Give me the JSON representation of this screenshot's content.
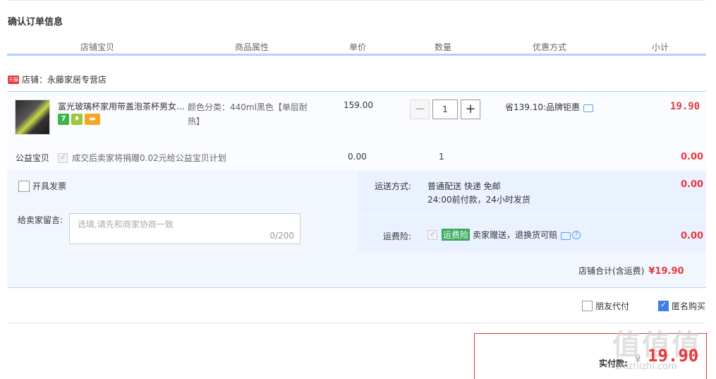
{
  "title": "确认订单信息",
  "table_headers": [
    "店铺宝贝",
    "商品属性",
    "单价",
    "数量",
    "优惠方式",
    "小计"
  ],
  "shop": {
    "icon": "tmall-icon",
    "icon_text": "天猫",
    "label": "店铺：永藤家居专营店"
  },
  "item": {
    "title": "富光玻璃杯家用带盖泡茶杯男女...",
    "attr": "颜色分类：440ml黑色【单层耐热】",
    "price": "159.00",
    "qty": "1",
    "qty_minus": "−",
    "qty_plus": "+",
    "promo": "省139.10:品牌钜惠",
    "subtotal": "19.90",
    "badges": [
      "7",
      "♦",
      "▬"
    ]
  },
  "charity": {
    "label": "公益宝贝",
    "text": "成交后卖家将捐赠0.02元给公益宝贝计划",
    "price": "0.00",
    "qty": "1",
    "subtotal": "0.00"
  },
  "invoice": {
    "label": "开具发票"
  },
  "message": {
    "label": "给卖家留言:",
    "placeholder": "选填,请先和商家协商一致",
    "count": "0/200"
  },
  "shipping": {
    "label": "运送方式:",
    "line1": "普通配送 快递 免邮",
    "line2": "24:00前付款，24小时发货",
    "subtotal": "0.00"
  },
  "insurance": {
    "label": "运费险:",
    "tag": "运费险",
    "text": "卖家赠送，退换货可赔",
    "subtotal": "0.00"
  },
  "shop_total": {
    "label": "店铺合计(含运费)",
    "value": "¥19.90"
  },
  "options": {
    "friend_pay": "朋友代付",
    "anonymous": "匿名购买"
  },
  "payment": {
    "label": "实付款:",
    "currency": "¥",
    "value": "19.90"
  },
  "watermark": {
    "big": "值值值",
    "small": "zhizhizhi.com"
  },
  "colors": {
    "accent_red": "#e4393c",
    "header_line": "#b2d1ff",
    "panel_bg": "#f2f7ff"
  }
}
